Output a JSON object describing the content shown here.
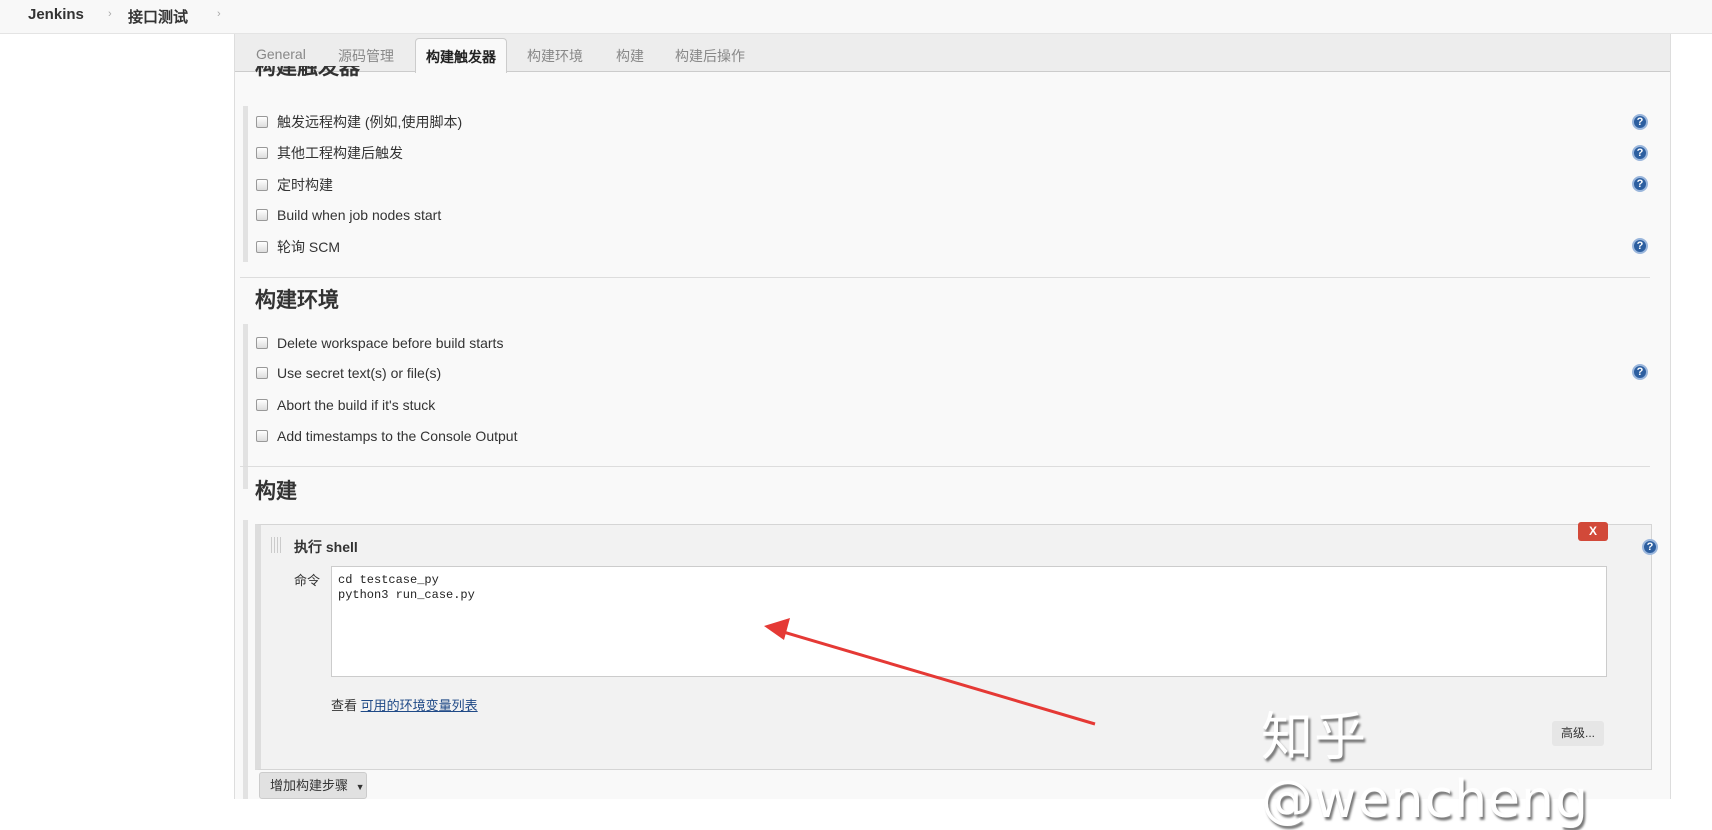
{
  "header": {
    "breadcrumb": [
      "Jenkins",
      "接口测试"
    ]
  },
  "tabs": [
    "General",
    "源码管理",
    "构建触发器",
    "构建环境",
    "构建",
    "构建后操作"
  ],
  "active_tab": "构建触发器",
  "triggers": {
    "title": "构建触发器",
    "items": [
      {
        "label": "触发远程构建 (例如,使用脚本)",
        "checked": false,
        "help": true
      },
      {
        "label": "其他工程构建后触发",
        "checked": false,
        "help": true
      },
      {
        "label": "定时构建",
        "checked": false,
        "help": true
      },
      {
        "label": "Build when job nodes start",
        "checked": false,
        "help": false
      },
      {
        "label": "轮询 SCM",
        "checked": false,
        "help": true
      }
    ]
  },
  "environment": {
    "title": "构建环境",
    "items": [
      {
        "label": "Delete workspace before build starts",
        "checked": false,
        "help": false
      },
      {
        "label": "Use secret text(s) or file(s)",
        "checked": false,
        "help": true
      },
      {
        "label": "Abort the build if it's stuck",
        "checked": false,
        "help": false
      },
      {
        "label": "Add timestamps to the Console Output",
        "checked": false,
        "help": false
      }
    ]
  },
  "build": {
    "title": "构建",
    "step": {
      "title": "执行 shell",
      "delete_label": "X",
      "command_label": "命令",
      "command": "cd testcase_py\npython3 run_case.py",
      "env_prefix": "查看",
      "env_link": "可用的环境变量列表",
      "advanced_label": "高级..."
    },
    "add_step_label": "增加构建步骤"
  },
  "watermark": "知乎 @wencheng",
  "colors": {
    "delete": "#d24939",
    "help": "#2d5fa0",
    "link": "#204a87",
    "arrow": "#e53935"
  }
}
